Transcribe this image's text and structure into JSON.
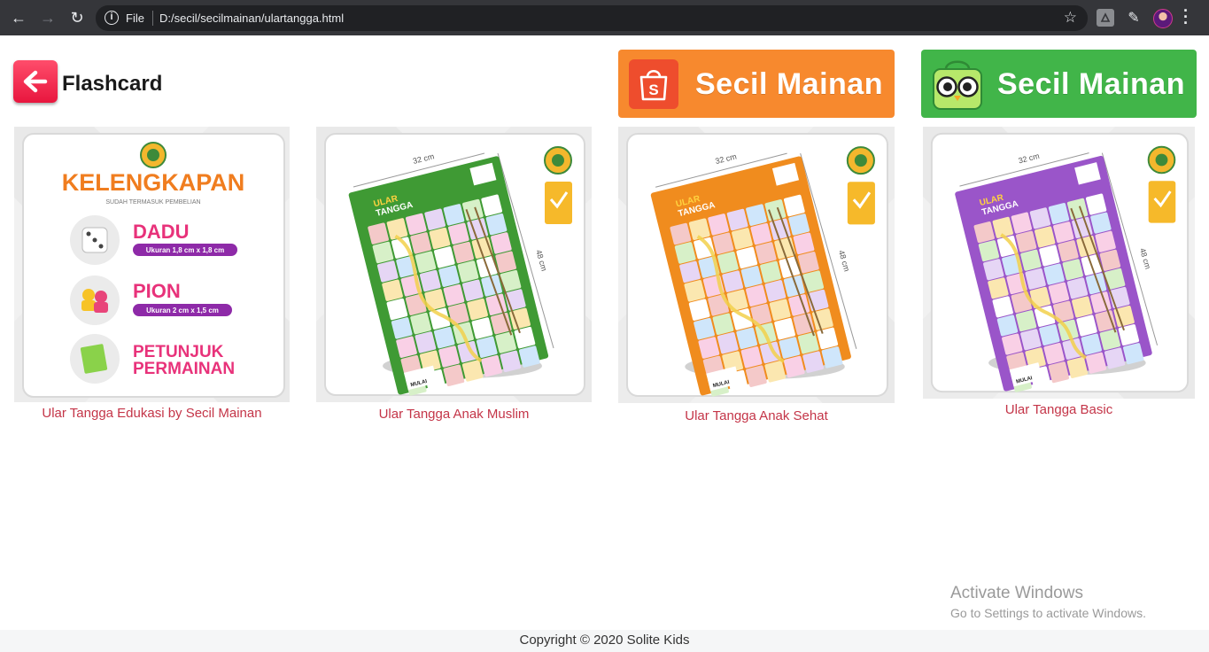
{
  "browser": {
    "scheme": "File",
    "url": "D:/secil/secilmainan/ulartangga.html"
  },
  "header": {
    "title": "Flashcard"
  },
  "stores": [
    {
      "name": "shopee",
      "label": "Secil Mainan",
      "color": "#f7892e"
    },
    {
      "name": "tokopedia",
      "label": "Secil Mainan",
      "color": "#41b549"
    }
  ],
  "products": [
    {
      "caption": "Ular Tangga Edukasi by Secil Mainan"
    },
    {
      "caption": "Ular Tangga Anak Muslim",
      "board_color": "#3f9a34"
    },
    {
      "caption": "Ular Tangga Anak Sehat",
      "board_color": "#f08c1e"
    },
    {
      "caption": "Ular Tangga Basic",
      "board_color": "#9a55c9"
    }
  ],
  "kelengkapan": {
    "heading": "KELENGKAPAN",
    "subheading": "SUDAH TERMASUK PEMBELIAN",
    "items": [
      {
        "name": "DADU",
        "size": "Ukuran 1,8 cm x 1,8 cm"
      },
      {
        "name": "PION",
        "size": "Ukuran 2 cm x 1,5 cm"
      },
      {
        "name": "PETUNJUK",
        "name2": "PERMAINAN"
      }
    ]
  },
  "board_labels": {
    "width": "32 cm",
    "height": "48 cm",
    "start": "MULAI",
    "title_top": "ULAR",
    "title_bottom": "TANGGA"
  },
  "watermark": {
    "line1": "Activate Windows",
    "line2": "Go to Settings to activate Windows."
  },
  "footer": {
    "copyright": "Copyright © 2020 Solite Kids"
  }
}
